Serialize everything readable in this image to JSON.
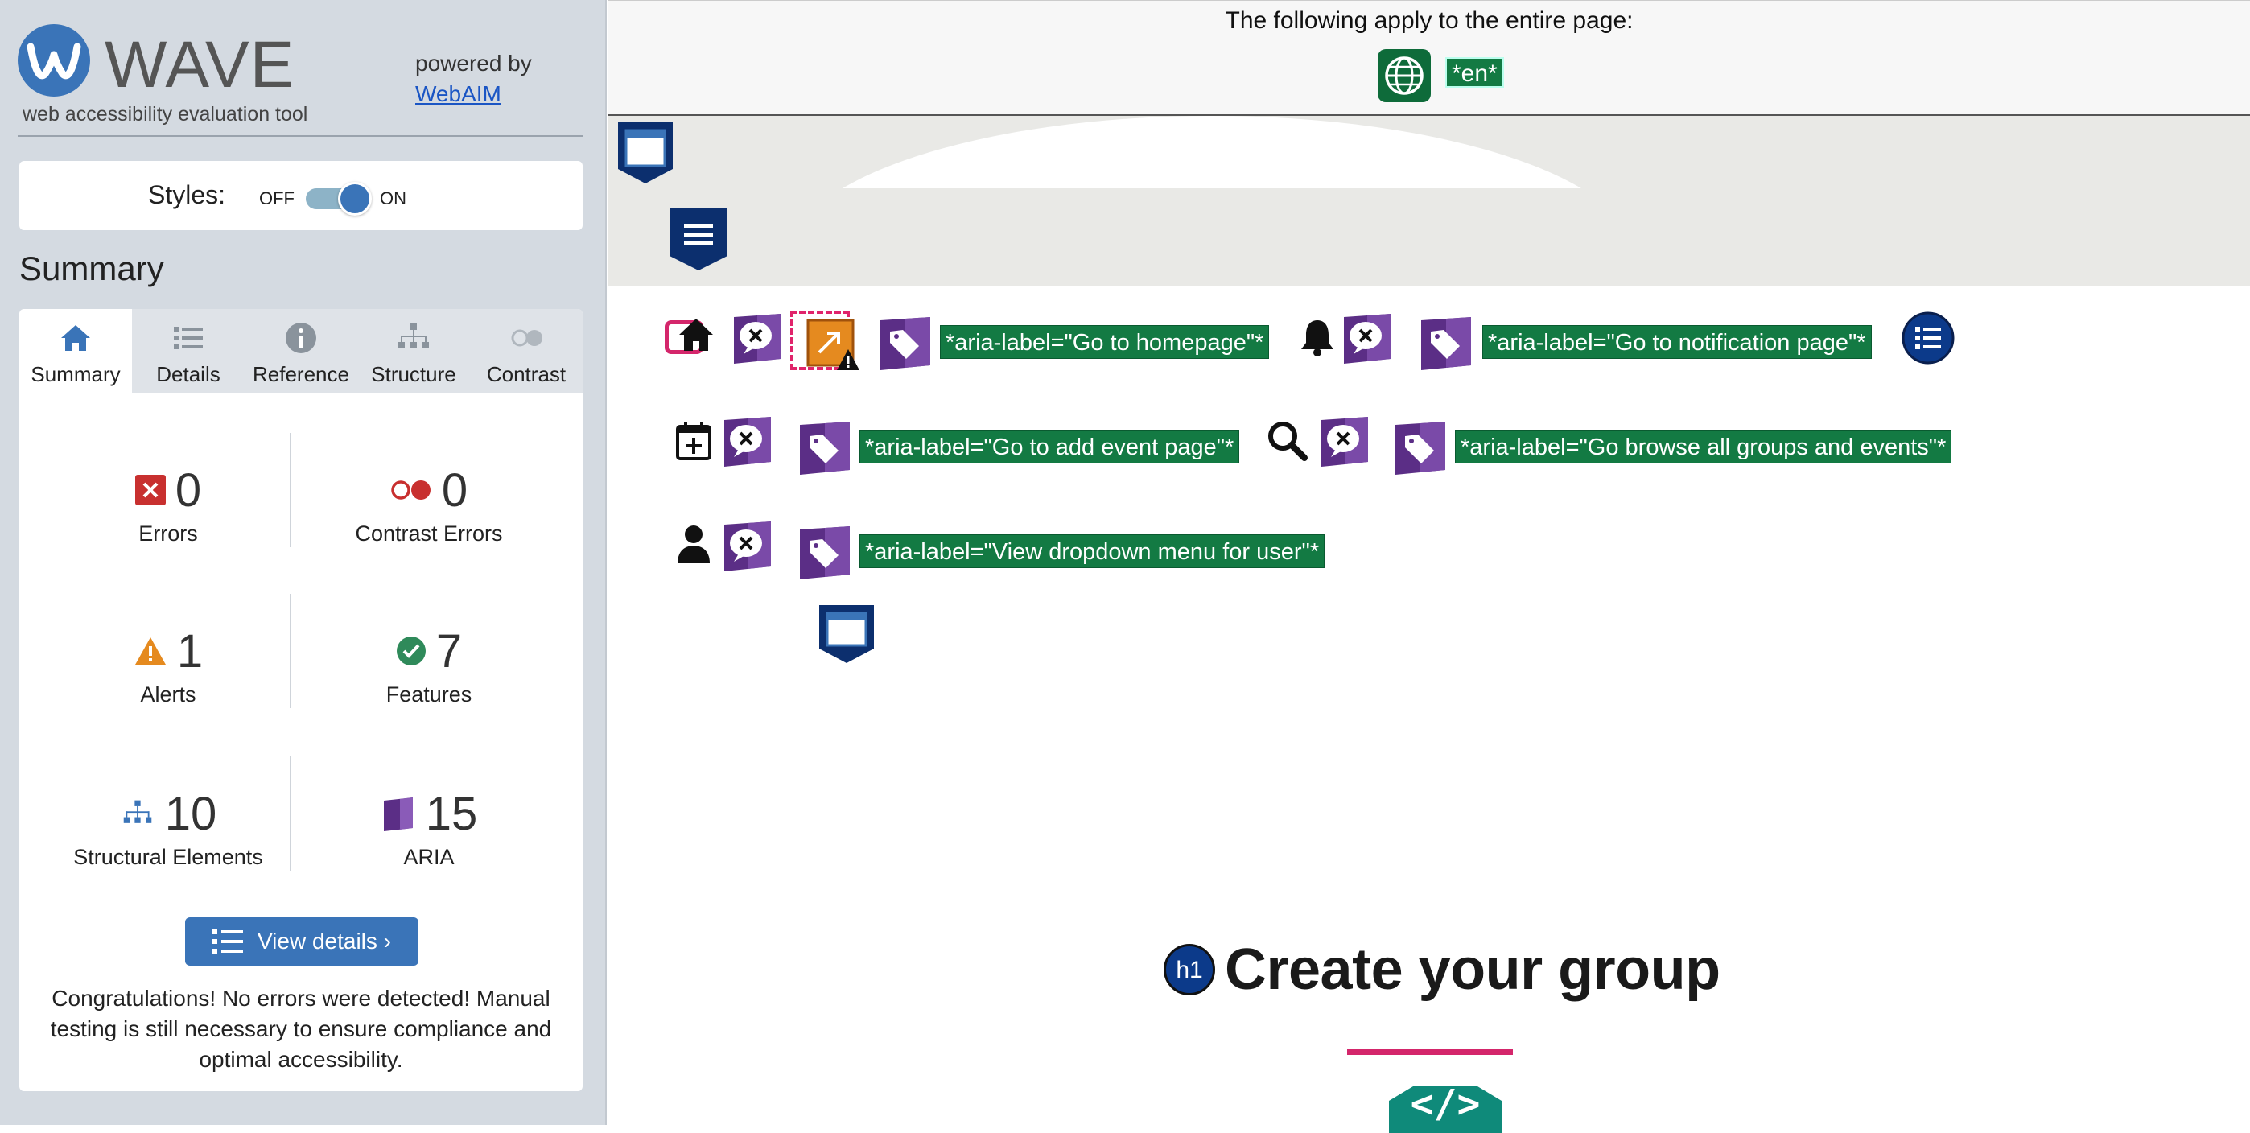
{
  "sidebar": {
    "logo_word": "WAVE",
    "logo_tagline": "web accessibility evaluation tool",
    "powered_by": "powered by",
    "powered_link": "WebAIM",
    "styles_label": "Styles:",
    "toggle_off": "OFF",
    "toggle_on": "ON",
    "summary_heading": "Summary",
    "tabs": [
      {
        "label": "Summary",
        "icon": "home-icon"
      },
      {
        "label": "Details",
        "icon": "list-icon"
      },
      {
        "label": "Reference",
        "icon": "info-icon"
      },
      {
        "label": "Structure",
        "icon": "structure-icon"
      },
      {
        "label": "Contrast",
        "icon": "contrast-icon"
      }
    ],
    "stats": {
      "errors": {
        "count": "0",
        "label": "Errors"
      },
      "contrast_errors": {
        "count": "0",
        "label": "Contrast Errors"
      },
      "alerts": {
        "count": "1",
        "label": "Alerts"
      },
      "features": {
        "count": "7",
        "label": "Features"
      },
      "structural": {
        "count": "10",
        "label": "Structural Elements"
      },
      "aria": {
        "count": "15",
        "label": "ARIA"
      }
    },
    "view_details": "View details ›",
    "congrats": "Congratulations! No errors were detected! Manual testing is still necessary to ensure compliance and optimal accessibility."
  },
  "main": {
    "banner_text": "The following apply to the entire page:",
    "lang_badge": "*en*",
    "aria_labels": {
      "home": "*aria-label=\"Go to homepage\"*",
      "notification": "*aria-label=\"Go to notification page\"*",
      "add_event": "*aria-label=\"Go to add event page\"*",
      "browse": "*aria-label=\"Go browse all groups and events\"*",
      "user": "*aria-label=\"View dropdown menu for user\"*"
    },
    "h1_badge": "h1",
    "heading": "Create your group",
    "code_symbol": "</>"
  },
  "colors": {
    "wave_blue": "#3a74b8",
    "aria_purple": "#5b2e86",
    "feature_green": "#137a43",
    "error_red": "#c8302f",
    "alert_orange": "#e58a1f",
    "accent_pink": "#d4266b"
  }
}
